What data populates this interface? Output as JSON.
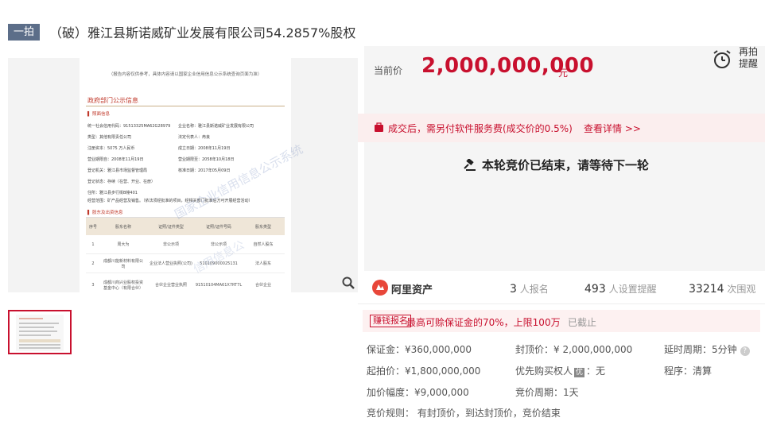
{
  "header": {
    "tag": "一拍",
    "title": "（破）雅江县斯诺威矿业发展有限公司54.2857%股权"
  },
  "doc": {
    "top_note": "（报告内容仅供参考，具体内容请以国家企业信用信息公示系统查询页面为准）",
    "section_title": "政府部门公示信息",
    "sub1": "▌ 照面信息",
    "rows_left": [
      "统一社会信用代码：91513325MA62G28979",
      "类型：其他有限责任公司",
      "注册资本：5075 万人民币",
      "营业期限自：2008年11月19日",
      "登记机关：雅江县市场监督管理局",
      "登记状态：存续（在营、开业、在册）",
      "住所：雅江县步行街B幢401",
      "经营范围：矿产品经营及销售。（依法须经批准的项目，经相关部门批准后方可开展经营活动）"
    ],
    "rows_right": [
      "企业名称：雅江县斯诺威矿业发展有限公司",
      "法定代表人：冉良",
      "成立日期：2008年11月19日",
      "营业期限至：2058年10月18日",
      "核准日期：2017年05月09日"
    ],
    "sub2": "▌ 股东及出资信息",
    "table_head": [
      "序号",
      "股东名称",
      "证照/证件类型",
      "证照/证件号码",
      "股东类型"
    ],
    "table_rows": [
      [
        "1",
        "周大为",
        "非公示项",
        "非公示项",
        "自然人股东"
      ],
      [
        "2",
        "成都川能新材料有限公司",
        "企业法人营业执照(公司)",
        "510109000025131",
        "法人股东"
      ],
      [
        "3",
        "成都川商兴业股权投资基金中心（有限合伙）",
        "合伙企业营业执照",
        "91510104MA61X7RT7L",
        "合伙企业"
      ]
    ],
    "watermark": "国家企业信用信息公示系统",
    "watermark2": "信用信息公"
  },
  "price": {
    "label": "当前价",
    "value": "2,000,000,000",
    "unit": "元",
    "remind": "再拍提醒"
  },
  "fee": {
    "text": "成交后，需另付软件服务费(成交价的0.5%)",
    "link": "查看详情 >>"
  },
  "status": "本轮竞价已结束，请等待下一轮",
  "stats": {
    "logo": "阿里资产",
    "signup_count": "3",
    "signup_label": "人报名",
    "reminder_count": "493",
    "reminder_label": "人设置提醒",
    "view_count": "33214",
    "view_label": "次围观"
  },
  "promo": {
    "tag": "赚钱报名",
    "text": "最高可赊保证金的70%，上限100万",
    "end": "已截止"
  },
  "info": {
    "deposit": "保证金：¥360,000,000",
    "cap_price": "封顶价：¥ 2,000,000,000",
    "delay": "延时周期：5分钟",
    "start_price": "起拍价：¥1,800,000,000",
    "priority_label": "优先购买权人",
    "priority_badge": "优",
    "priority_value": "：无",
    "procedure": "程序：清算",
    "increment": "加价幅度：¥9,000,000",
    "bid_cycle": "竞价周期：1天",
    "rule": "竞价规则： 有封顶价，到达封顶价，竞价结束"
  }
}
